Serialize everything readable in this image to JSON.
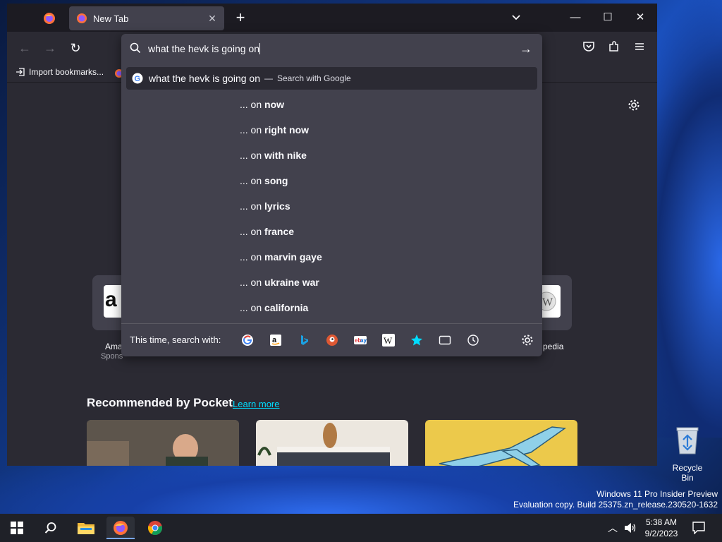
{
  "browser": {
    "tab_title": "New Tab",
    "bookmarks_import": "Import bookmarks...",
    "pocket_title": "Recommended by Pocket",
    "pocket_learn_more": "Learn more",
    "shortcuts": [
      {
        "label": "Ama",
        "sponsored": "Spons"
      },
      {
        "label": "pedia"
      }
    ]
  },
  "urlbar": {
    "value": "what the hevk is going on",
    "heuristic": {
      "text": "what the hevk is going on",
      "separator": "—",
      "action": "Search with Google"
    },
    "suggestion_prefix": "... on",
    "suggestions": [
      "now",
      "right now",
      "with nike",
      "song",
      "lyrics",
      "france",
      "marvin gaye",
      "ukraine war",
      "california"
    ],
    "oneoff_label": "This time, search with:",
    "oneoff_engines": [
      "google-icon",
      "amazon-icon",
      "bing-icon",
      "duckduckgo-icon",
      "ebay-icon",
      "wikipedia-icon",
      "bookmarks-star-icon",
      "tabs-icon",
      "history-icon",
      "gear-icon"
    ]
  },
  "desktop": {
    "recycle_bin": "Recycle Bin",
    "watermark_line1": "Windows 11 Pro Insider Preview",
    "watermark_line2": "Evaluation copy. Build 25375.zn_release.230520-1632"
  },
  "taskbar": {
    "time": "5:38 AM",
    "date": "9/2/2023"
  },
  "colors": {
    "accent": "#00ddff",
    "panel": "#42414d",
    "chrome": "#2b2a33"
  }
}
